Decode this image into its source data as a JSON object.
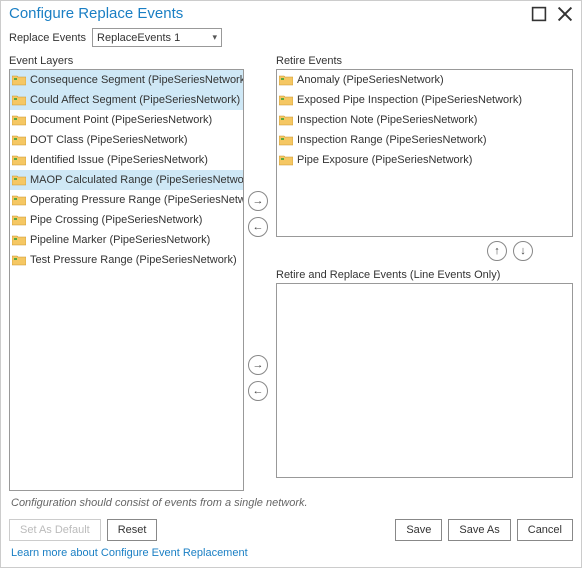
{
  "window": {
    "title": "Configure Replace Events"
  },
  "config": {
    "label": "Replace Events",
    "value": "ReplaceEvents 1"
  },
  "panels": {
    "event_layers_label": "Event Layers",
    "retire_label": "Retire Events",
    "replace_label": "Retire and Replace Events (Line Events Only)"
  },
  "event_layers": [
    {
      "label": "Consequence Segment (PipeSeriesNetwork)",
      "selected": true
    },
    {
      "label": "Could Affect Segment (PipeSeriesNetwork)",
      "selected": true
    },
    {
      "label": "Document Point (PipeSeriesNetwork)",
      "selected": false
    },
    {
      "label": "DOT Class (PipeSeriesNetwork)",
      "selected": false
    },
    {
      "label": "Identified Issue (PipeSeriesNetwork)",
      "selected": false
    },
    {
      "label": "MAOP Calculated Range (PipeSeriesNetwork)",
      "selected": true
    },
    {
      "label": "Operating Pressure Range (PipeSeriesNetwork)",
      "selected": false
    },
    {
      "label": "Pipe Crossing (PipeSeriesNetwork)",
      "selected": false
    },
    {
      "label": "Pipeline Marker (PipeSeriesNetwork)",
      "selected": false
    },
    {
      "label": "Test Pressure Range (PipeSeriesNetwork)",
      "selected": false
    }
  ],
  "retire_events": [
    {
      "label": "Anomaly (PipeSeriesNetwork)"
    },
    {
      "label": "Exposed Pipe Inspection (PipeSeriesNetwork)"
    },
    {
      "label": "Inspection Note (PipeSeriesNetwork)"
    },
    {
      "label": "Inspection Range (PipeSeriesNetwork)"
    },
    {
      "label": "Pipe Exposure (PipeSeriesNetwork)"
    }
  ],
  "note": "Configuration should consist of events from a single network.",
  "buttons": {
    "set_default": "Set As Default",
    "reset": "Reset",
    "save": "Save",
    "save_as": "Save As",
    "cancel": "Cancel"
  },
  "link": "Learn more about Configure Event Replacement"
}
